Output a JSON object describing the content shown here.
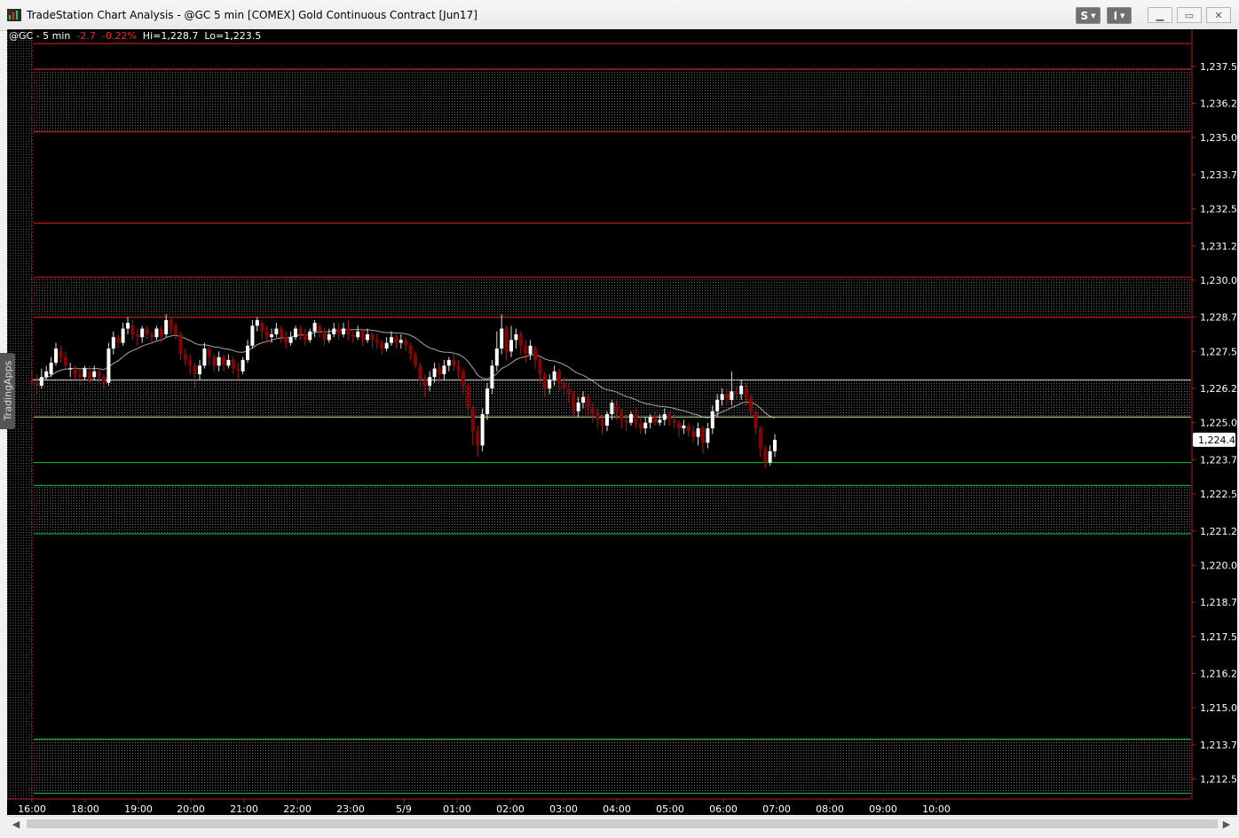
{
  "window": {
    "title": "TradeStation Chart Analysis - @GC 5 min [COMEX] Gold Continuous Contract [Jun17]",
    "buttons": [
      "S",
      "I"
    ]
  },
  "infobar": {
    "symbol": "@GC - 5 min",
    "change": "-2.7",
    "change_pct": "-0.22%",
    "high": "Hi=1,228.7",
    "low": "Lo=1,223.5"
  },
  "side_tab": "TradingApps",
  "colors": {
    "background": "#000000",
    "bull": "#ffffff",
    "bear": "#8b0000",
    "resistance": "#e02020",
    "support": "#20c040",
    "vwap": "#cfcfcf",
    "last_price_box": "#ffffff"
  },
  "chart_data": {
    "type": "candlestick",
    "symbol": "@GC",
    "interval": "5 min",
    "y_ticks": [
      "1,237.5",
      "1,236.2",
      "1,235.0",
      "1,233.7",
      "1,232.5",
      "1,231.2",
      "1,230.0",
      "1,228.7",
      "1,227.5",
      "1,226.2",
      "1,225.0",
      "1,223.7",
      "1,222.5",
      "1,221.2",
      "1,220.0",
      "1,218.7",
      "1,217.5",
      "1,216.2",
      "1,215.0",
      "1,213.7",
      "1,212.5"
    ],
    "ylim": [
      1211.8,
      1238.8
    ],
    "x_ticks": [
      "16:00",
      "18:00",
      "19:00",
      "20:00",
      "21:00",
      "22:00",
      "23:00",
      "5/9",
      "01:00",
      "02:00",
      "03:00",
      "04:00",
      "05:00",
      "06:00",
      "07:00",
      "08:00",
      "09:00",
      "10:00"
    ],
    "last_price": "1,224.4",
    "last_price_value": 1224.4,
    "resistance_zones": [
      {
        "from": 1237.4,
        "to": 1235.2
      },
      {
        "from": 1230.1,
        "to": 1228.7
      }
    ],
    "resistance_lines": [
      1238.3,
      1232.0
    ],
    "mixed_zone": {
      "from": 1226.5,
      "to": 1225.2
    },
    "support_lines": [
      1223.6
    ],
    "support_zones": [
      {
        "from": 1222.8,
        "to": 1221.1
      },
      {
        "from": 1213.9,
        "to": 1212.0
      }
    ],
    "candles": [
      [
        1226.5,
        1226.4,
        1226.8,
        1226.3
      ],
      [
        1226.4,
        1226.3,
        1226.7,
        1226.0
      ],
      [
        1226.3,
        1226.6,
        1226.9,
        1226.2
      ],
      [
        1226.6,
        1226.8,
        1227.0,
        1226.5
      ],
      [
        1226.7,
        1227.1,
        1227.3,
        1226.6
      ],
      [
        1227.1,
        1227.6,
        1227.8,
        1227.0
      ],
      [
        1227.5,
        1227.3,
        1227.7,
        1227.1
      ],
      [
        1227.3,
        1227.0,
        1227.5,
        1226.9
      ],
      [
        1226.9,
        1226.9,
        1227.1,
        1226.6
      ],
      [
        1226.9,
        1226.7,
        1227.0,
        1226.5
      ],
      [
        1226.7,
        1226.6,
        1226.9,
        1226.3
      ],
      [
        1226.6,
        1226.9,
        1227.0,
        1226.5
      ],
      [
        1226.8,
        1226.5,
        1227.0,
        1226.4
      ],
      [
        1226.6,
        1226.8,
        1227.0,
        1226.5
      ],
      [
        1226.8,
        1226.6,
        1226.9,
        1226.4
      ],
      [
        1226.6,
        1226.4,
        1226.7,
        1226.2
      ],
      [
        1226.4,
        1227.6,
        1227.8,
        1226.3
      ],
      [
        1227.6,
        1228.0,
        1228.2,
        1227.4
      ],
      [
        1228.0,
        1227.8,
        1228.1,
        1227.6
      ],
      [
        1227.8,
        1228.3,
        1228.5,
        1227.7
      ],
      [
        1228.3,
        1228.5,
        1228.7,
        1228.1
      ],
      [
        1228.4,
        1228.1,
        1228.6,
        1227.9
      ],
      [
        1228.1,
        1228.0,
        1228.3,
        1227.7
      ],
      [
        1228.0,
        1228.3,
        1228.4,
        1227.8
      ],
      [
        1228.3,
        1228.1,
        1228.4,
        1227.9
      ],
      [
        1228.1,
        1228.0,
        1228.2,
        1227.8
      ],
      [
        1228.0,
        1228.3,
        1228.4,
        1227.9
      ],
      [
        1228.3,
        1228.0,
        1228.4,
        1227.8
      ],
      [
        1228.1,
        1228.6,
        1228.8,
        1228.0
      ],
      [
        1228.6,
        1228.3,
        1228.7,
        1228.1
      ],
      [
        1228.4,
        1228.1,
        1228.5,
        1227.9
      ],
      [
        1228.1,
        1227.4,
        1228.2,
        1227.2
      ],
      [
        1227.4,
        1227.2,
        1227.6,
        1227.0
      ],
      [
        1227.2,
        1227.0,
        1227.4,
        1226.7
      ],
      [
        1227.0,
        1226.7,
        1227.1,
        1226.2
      ],
      [
        1226.7,
        1227.0,
        1227.2,
        1226.5
      ],
      [
        1227.0,
        1227.6,
        1227.8,
        1226.9
      ],
      [
        1227.6,
        1227.3,
        1227.7,
        1227.0
      ],
      [
        1227.3,
        1227.0,
        1227.4,
        1226.8
      ],
      [
        1227.0,
        1227.3,
        1227.5,
        1226.8
      ],
      [
        1227.3,
        1227.0,
        1227.4,
        1226.8
      ],
      [
        1227.0,
        1227.2,
        1227.4,
        1226.9
      ],
      [
        1227.2,
        1226.9,
        1227.3,
        1226.7
      ],
      [
        1226.9,
        1226.8,
        1227.1,
        1226.5
      ],
      [
        1226.8,
        1227.2,
        1227.3,
        1226.7
      ],
      [
        1227.2,
        1227.7,
        1227.9,
        1227.1
      ],
      [
        1227.7,
        1228.4,
        1228.6,
        1227.6
      ],
      [
        1228.4,
        1228.6,
        1228.7,
        1228.2
      ],
      [
        1228.5,
        1228.2,
        1228.6,
        1227.9
      ],
      [
        1228.2,
        1228.0,
        1228.4,
        1227.8
      ],
      [
        1228.0,
        1228.1,
        1228.3,
        1227.8
      ],
      [
        1228.1,
        1228.3,
        1228.5,
        1228.0
      ],
      [
        1228.3,
        1228.0,
        1228.4,
        1227.8
      ],
      [
        1228.0,
        1227.8,
        1228.2,
        1227.6
      ],
      [
        1227.8,
        1228.0,
        1228.2,
        1227.7
      ],
      [
        1228.0,
        1228.3,
        1228.4,
        1227.9
      ],
      [
        1228.3,
        1228.1,
        1228.4,
        1227.9
      ],
      [
        1228.1,
        1227.9,
        1228.3,
        1227.7
      ],
      [
        1227.9,
        1228.2,
        1228.3,
        1227.8
      ],
      [
        1228.2,
        1228.5,
        1228.6,
        1228.0
      ],
      [
        1228.4,
        1228.2,
        1228.5,
        1228.0
      ],
      [
        1228.2,
        1227.9,
        1228.3,
        1227.7
      ],
      [
        1227.9,
        1228.1,
        1228.3,
        1227.8
      ],
      [
        1228.1,
        1228.3,
        1228.5,
        1228.0
      ],
      [
        1228.3,
        1228.1,
        1228.5,
        1227.9
      ],
      [
        1228.1,
        1228.3,
        1228.5,
        1228.0
      ],
      [
        1228.3,
        1228.1,
        1228.6,
        1227.9
      ],
      [
        1228.1,
        1228.0,
        1228.3,
        1227.8
      ],
      [
        1228.0,
        1228.2,
        1228.4,
        1227.9
      ],
      [
        1228.2,
        1227.9,
        1228.3,
        1227.7
      ],
      [
        1227.9,
        1228.1,
        1228.3,
        1227.8
      ],
      [
        1228.1,
        1227.9,
        1228.2,
        1227.6
      ],
      [
        1227.9,
        1227.8,
        1228.1,
        1227.6
      ],
      [
        1227.8,
        1227.6,
        1227.9,
        1227.4
      ],
      [
        1227.6,
        1227.8,
        1228.0,
        1227.5
      ],
      [
        1227.8,
        1228.0,
        1228.2,
        1227.7
      ],
      [
        1228.0,
        1227.8,
        1228.1,
        1227.6
      ],
      [
        1227.8,
        1227.9,
        1228.1,
        1227.6
      ],
      [
        1227.9,
        1227.7,
        1228.0,
        1227.5
      ],
      [
        1227.7,
        1227.4,
        1227.8,
        1227.2
      ],
      [
        1227.4,
        1227.0,
        1227.5,
        1226.9
      ],
      [
        1227.0,
        1226.5,
        1227.1,
        1226.3
      ],
      [
        1226.5,
        1226.3,
        1226.7,
        1225.9
      ],
      [
        1226.3,
        1226.6,
        1226.8,
        1226.1
      ],
      [
        1226.6,
        1226.9,
        1227.1,
        1226.4
      ],
      [
        1226.9,
        1226.7,
        1227.1,
        1226.4
      ],
      [
        1226.7,
        1227.0,
        1227.2,
        1226.5
      ],
      [
        1227.0,
        1227.2,
        1227.3,
        1226.8
      ],
      [
        1227.2,
        1227.0,
        1227.5,
        1226.8
      ],
      [
        1227.0,
        1226.8,
        1227.2,
        1226.5
      ],
      [
        1226.8,
        1226.3,
        1226.9,
        1226.0
      ],
      [
        1226.3,
        1225.5,
        1226.4,
        1225.2
      ],
      [
        1225.5,
        1224.7,
        1225.6,
        1224.2
      ],
      [
        1224.7,
        1224.2,
        1224.9,
        1223.8
      ],
      [
        1224.2,
        1225.3,
        1225.5,
        1224.0
      ],
      [
        1225.3,
        1226.2,
        1226.4,
        1225.1
      ],
      [
        1226.2,
        1227.0,
        1227.2,
        1226.0
      ],
      [
        1227.0,
        1227.6,
        1228.2,
        1226.8
      ],
      [
        1227.6,
        1228.3,
        1228.8,
        1227.4
      ],
      [
        1228.3,
        1227.5,
        1228.4,
        1227.2
      ],
      [
        1227.5,
        1227.9,
        1228.4,
        1227.3
      ],
      [
        1227.9,
        1228.1,
        1228.3,
        1227.6
      ],
      [
        1228.1,
        1227.7,
        1228.2,
        1227.4
      ],
      [
        1227.7,
        1227.4,
        1227.9,
        1227.1
      ],
      [
        1227.4,
        1227.7,
        1227.9,
        1227.2
      ],
      [
        1227.6,
        1227.2,
        1227.7,
        1226.9
      ],
      [
        1227.2,
        1226.7,
        1227.3,
        1226.4
      ],
      [
        1226.7,
        1226.2,
        1226.8,
        1225.9
      ],
      [
        1226.2,
        1226.5,
        1226.7,
        1226.0
      ],
      [
        1226.5,
        1226.8,
        1227.0,
        1226.3
      ],
      [
        1226.8,
        1226.4,
        1226.9,
        1226.1
      ],
      [
        1226.4,
        1226.2,
        1226.6,
        1225.9
      ],
      [
        1226.2,
        1226.0,
        1226.4,
        1225.7
      ],
      [
        1226.0,
        1225.4,
        1226.1,
        1225.2
      ],
      [
        1225.4,
        1225.7,
        1225.9,
        1225.2
      ],
      [
        1225.7,
        1225.9,
        1226.1,
        1225.5
      ],
      [
        1225.9,
        1225.5,
        1226.0,
        1225.2
      ],
      [
        1225.5,
        1225.3,
        1225.7,
        1225.0
      ],
      [
        1225.3,
        1225.1,
        1225.5,
        1224.8
      ],
      [
        1225.1,
        1224.9,
        1225.3,
        1224.6
      ],
      [
        1224.9,
        1225.3,
        1225.4,
        1224.7
      ],
      [
        1225.3,
        1225.7,
        1225.8,
        1225.1
      ],
      [
        1225.6,
        1225.4,
        1225.8,
        1225.1
      ],
      [
        1225.4,
        1225.1,
        1225.5,
        1224.8
      ],
      [
        1225.1,
        1225.0,
        1225.3,
        1224.7
      ],
      [
        1225.0,
        1225.3,
        1225.4,
        1224.9
      ],
      [
        1225.3,
        1225.0,
        1225.5,
        1224.8
      ],
      [
        1225.0,
        1224.8,
        1225.2,
        1224.6
      ],
      [
        1224.8,
        1225.0,
        1225.2,
        1224.6
      ],
      [
        1225.0,
        1225.2,
        1225.3,
        1224.8
      ],
      [
        1225.2,
        1225.0,
        1225.4,
        1224.9
      ],
      [
        1225.0,
        1225.1,
        1225.3,
        1224.9
      ],
      [
        1225.1,
        1225.3,
        1225.5,
        1224.9
      ],
      [
        1225.3,
        1225.1,
        1225.4,
        1224.9
      ],
      [
        1225.1,
        1225.0,
        1225.3,
        1224.8
      ],
      [
        1225.0,
        1224.8,
        1225.1,
        1224.5
      ],
      [
        1224.8,
        1224.9,
        1225.1,
        1224.6
      ],
      [
        1224.9,
        1224.7,
        1225.0,
        1224.5
      ],
      [
        1224.7,
        1224.5,
        1224.9,
        1224.3
      ],
      [
        1224.5,
        1224.8,
        1225.0,
        1224.2
      ],
      [
        1224.8,
        1224.3,
        1224.9,
        1223.9
      ],
      [
        1224.3,
        1224.8,
        1225.0,
        1224.1
      ],
      [
        1224.8,
        1225.4,
        1225.6,
        1224.6
      ],
      [
        1225.4,
        1225.8,
        1226.0,
        1225.2
      ],
      [
        1225.8,
        1226.0,
        1226.2,
        1225.6
      ],
      [
        1226.0,
        1225.8,
        1226.2,
        1225.6
      ],
      [
        1225.8,
        1226.1,
        1226.8,
        1225.6
      ],
      [
        1226.1,
        1226.0,
        1226.3,
        1225.8
      ],
      [
        1226.0,
        1226.3,
        1226.5,
        1225.8
      ],
      [
        1226.2,
        1225.9,
        1226.4,
        1225.6
      ],
      [
        1225.9,
        1225.4,
        1226.0,
        1225.2
      ],
      [
        1225.4,
        1224.8,
        1225.5,
        1224.6
      ],
      [
        1224.8,
        1224.1,
        1224.9,
        1223.8
      ],
      [
        1224.1,
        1223.6,
        1224.2,
        1223.4
      ],
      [
        1223.6,
        1224.0,
        1224.2,
        1223.5
      ],
      [
        1224.0,
        1224.4,
        1224.6,
        1223.8
      ]
    ]
  }
}
